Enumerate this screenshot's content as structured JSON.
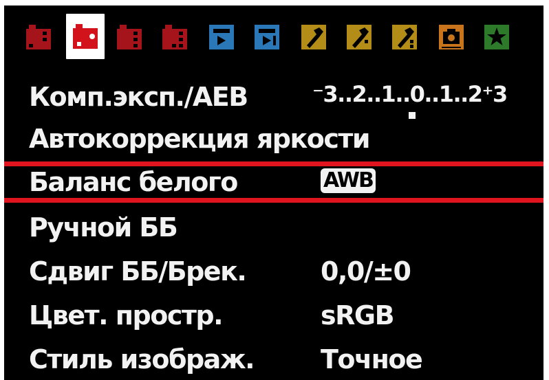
{
  "tabs": [
    {
      "icon": "shooting-camera-icon",
      "color": "#b3121a",
      "selected": false
    },
    {
      "icon": "shooting-camera-icon",
      "color": "#d3131c",
      "selected": true
    },
    {
      "icon": "shooting-camera-icon",
      "color": "#b3121a",
      "selected": false
    },
    {
      "icon": "shooting-camera-icon",
      "color": "#b3121a",
      "selected": false
    },
    {
      "icon": "playback-icon",
      "color": "#2a78b8",
      "selected": false
    },
    {
      "icon": "playback-icon",
      "color": "#2a78b8",
      "selected": false
    },
    {
      "icon": "setup-wrench-icon",
      "color": "#b48d18",
      "selected": false
    },
    {
      "icon": "setup-wrench-icon",
      "color": "#b48d18",
      "selected": false
    },
    {
      "icon": "setup-wrench-icon",
      "color": "#b48d18",
      "selected": false
    },
    {
      "icon": "live-view-camera-icon",
      "color": "#c8741c",
      "selected": false
    },
    {
      "icon": "my-menu-star-icon",
      "color": "#2c7a2a",
      "selected": false
    }
  ],
  "menu": {
    "items": [
      {
        "label": "Комп.эксп./AEB",
        "value": "⁻3..2..1..0..1..2⁺3"
      },
      {
        "label": "Автокоррекция яркости",
        "value": ""
      },
      {
        "label": "Баланс белого",
        "value": "AWB"
      },
      {
        "label": "Ручной ББ",
        "value": ""
      },
      {
        "label": "Сдвиг ББ/Брек.",
        "value": "0,0/±0"
      },
      {
        "label": "Цвет. простр.",
        "value": "sRGB"
      },
      {
        "label": "Стиль изображ.",
        "value": "Точное"
      }
    ],
    "selected_index": 2
  },
  "colors": {
    "background": "#000000",
    "highlight": "#e1151f",
    "text": "#f2f2f2"
  }
}
